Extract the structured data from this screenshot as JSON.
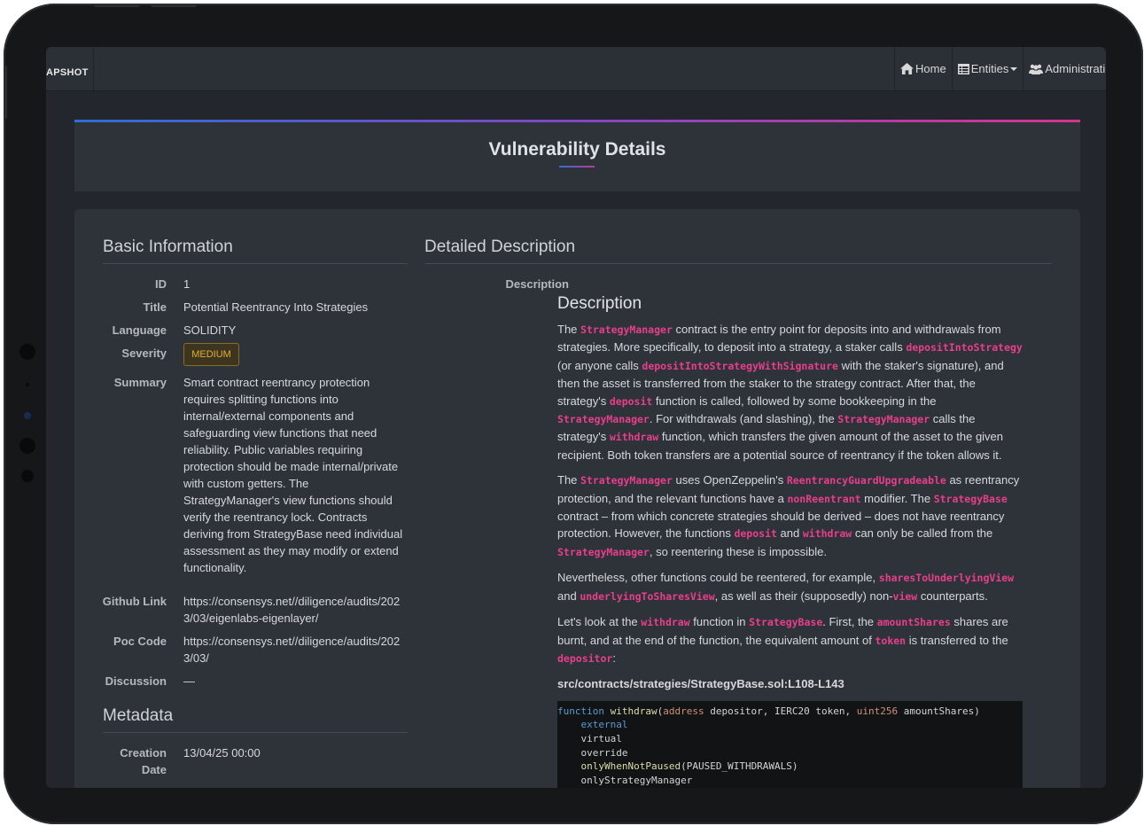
{
  "navbar": {
    "brand": "APSHOT",
    "home": "Home",
    "entities": "Entities",
    "administration": "Administrati"
  },
  "page": {
    "title": "Vulnerability Details"
  },
  "basic_info": {
    "heading": "Basic Information",
    "id_label": "ID",
    "id": "1",
    "title_label": "Title",
    "title": "Potential Reentrancy Into Strategies",
    "language_label": "Language",
    "language": "SOLIDITY",
    "severity_label": "Severity",
    "severity": "MEDIUM",
    "summary_label": "Summary",
    "summary_lines": [
      "Smart contract reentrancy protection",
      "requires splitting functions into",
      "internal/external components and",
      "safeguarding view functions that need",
      "reliability. Public variables requiring",
      "protection should be made internal/private",
      "with custom getters. The",
      "StrategyManager's view functions should",
      "verify the reentrancy lock. Contracts",
      "deriving from StrategyBase need individual",
      "assessment as they may modify or extend",
      "functionality."
    ],
    "github_label": "Github Link",
    "github_lines": [
      "https://consensys.net//diligence/audits/202",
      "3/03/eigenlabs-eigenlayer/"
    ],
    "poc_label": "Poc Code",
    "poc_lines": [
      "https://consensys.net//diligence/audits/202",
      "3/03/"
    ],
    "discussion_label": "Discussion",
    "discussion": "—"
  },
  "metadata": {
    "heading": "Metadata",
    "creation_label_1": "Creation",
    "creation_label_2": "Date",
    "creation_date": "13/04/25 00:00"
  },
  "detailed": {
    "heading": "Detailed Description",
    "desc_label": "Description",
    "desc_heading": "Description",
    "p1": [
      {
        "t": "The "
      },
      {
        "c": "StrategyManager"
      },
      {
        "t": " contract is the entry point for deposits into and withdrawals from strategies. More specifically, to deposit into a strategy, a staker calls "
      },
      {
        "c": "depositIntoStrategy"
      },
      {
        "t": " (or anyone calls "
      },
      {
        "c": "depositIntoStrategyWithSignature"
      },
      {
        "t": " with the staker's signature), and then the asset is transferred from the staker to the strategy contract. After that, the strategy's "
      },
      {
        "c": "deposit"
      },
      {
        "t": " function is called, followed by some bookkeeping in the "
      },
      {
        "c": "StrategyManager"
      },
      {
        "t": ". For withdrawals (and slashing), the "
      },
      {
        "c": "StrategyManager"
      },
      {
        "t": " calls the strategy's "
      },
      {
        "c": "withdraw"
      },
      {
        "t": " function, which transfers the given amount of the asset to the given recipient. Both token transfers are a potential source of reentrancy if the token allows it."
      }
    ],
    "p2": [
      {
        "t": "The "
      },
      {
        "c": "StrategyManager"
      },
      {
        "t": " uses OpenZeppelin's "
      },
      {
        "c": "ReentrancyGuardUpgradeable"
      },
      {
        "t": " as reentrancy protection, and the relevant functions have a "
      },
      {
        "c": "nonReentrant"
      },
      {
        "t": " modifier. The "
      },
      {
        "c": "StrategyBase"
      },
      {
        "t": " contract – from which concrete strategies should be derived – does not have reentrancy protection. However, the functions "
      },
      {
        "c": "deposit"
      },
      {
        "t": " and "
      },
      {
        "c": "withdraw"
      },
      {
        "t": " can only be called from the "
      },
      {
        "c": "StrategyManager"
      },
      {
        "t": ", so reentering these is impossible."
      }
    ],
    "p3": [
      {
        "t": "Nevertheless, other functions could be reentered, for example, "
      },
      {
        "c": "sharesToUnderlyingView"
      },
      {
        "t": " and "
      },
      {
        "c": "underlyingToSharesView"
      },
      {
        "t": ", as well as their (supposedly) non-"
      },
      {
        "c": "view"
      },
      {
        "t": " counterparts."
      }
    ],
    "p4": [
      {
        "t": "Let's look at the "
      },
      {
        "c": "withdraw"
      },
      {
        "t": " function in "
      },
      {
        "c": "StrategyBase"
      },
      {
        "t": ". First, the "
      },
      {
        "c": "amountShares"
      },
      {
        "t": " shares are burnt, and at the end of the function, the equivalent amount of "
      },
      {
        "c": "token"
      },
      {
        "t": " is transferred to the "
      },
      {
        "c": "depositor"
      },
      {
        "t": ":"
      }
    ],
    "file_path": "src/contracts/strategies/StrategyBase.sol:L108-L143",
    "code_lines": [
      [
        {
          "k": "function"
        },
        {
          "t": " "
        },
        {
          "f": "withdraw"
        },
        {
          "t": "("
        },
        {
          "y": "address"
        },
        {
          "t": " depositor, IERC20 token, "
        },
        {
          "y": "uint256"
        },
        {
          "t": " amountShares)"
        }
      ],
      [
        {
          "t": "    "
        },
        {
          "k": "external"
        }
      ],
      [
        {
          "t": "    virtual"
        }
      ],
      [
        {
          "t": "    override"
        }
      ],
      [
        {
          "t": "    "
        },
        {
          "f": "onlyWhenNotPaused"
        },
        {
          "t": "(PAUSED_WITHDRAWALS)"
        }
      ],
      [
        {
          "t": "    onlyStrategyManager"
        }
      ],
      [
        {
          "t": "{"
        }
      ]
    ]
  }
}
